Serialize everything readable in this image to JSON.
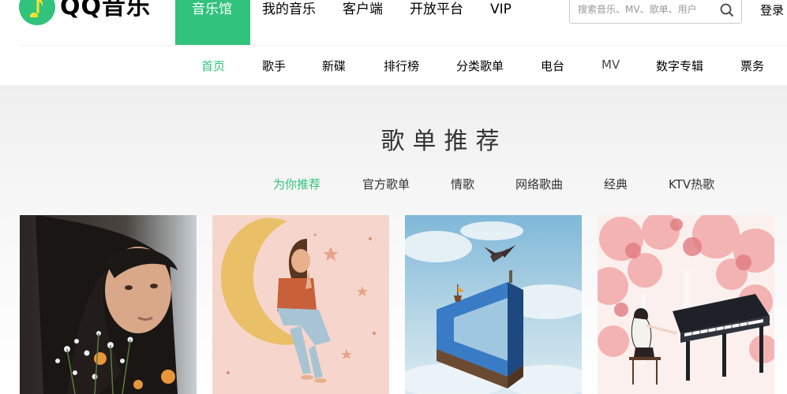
{
  "header": {
    "logo_text": "QQ音乐",
    "main_nav": [
      {
        "label": "音乐馆"
      },
      {
        "label": "我的音乐"
      },
      {
        "label": "客户端"
      },
      {
        "label": "开放平台"
      },
      {
        "label": "VIP"
      }
    ],
    "search": {
      "placeholder": "搜索音乐、MV、歌单、用户"
    },
    "login_label": "登录"
  },
  "sub_nav": [
    {
      "label": "首页"
    },
    {
      "label": "歌手"
    },
    {
      "label": "新碟"
    },
    {
      "label": "排行榜"
    },
    {
      "label": "分类歌单"
    },
    {
      "label": "电台"
    },
    {
      "label": "MV"
    },
    {
      "label": "数字专辑"
    },
    {
      "label": "票务"
    }
  ],
  "section": {
    "title": "歌单推荐",
    "tabs": [
      {
        "label": "为你推荐"
      },
      {
        "label": "官方歌单"
      },
      {
        "label": "情歌"
      },
      {
        "label": "网络歌曲"
      },
      {
        "label": "经典"
      },
      {
        "label": "KTV热歌"
      }
    ]
  },
  "playlists": [
    {
      "cover": "girl-with-flowers-photo"
    },
    {
      "cover": "girl-on-moon-illustration"
    },
    {
      "cover": "impossible-blue-shape-with-dragon"
    },
    {
      "cover": "girl-playing-piano-under-blossoms"
    }
  ],
  "colors": {
    "accent": "#31c27c",
    "text": "#000000",
    "section_bg": "#f0f0f0"
  }
}
